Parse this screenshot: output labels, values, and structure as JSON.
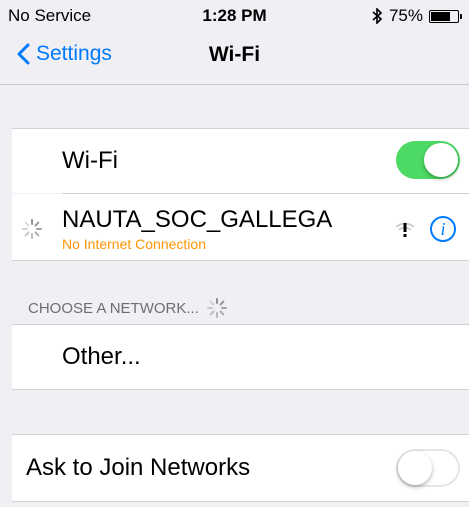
{
  "status_bar": {
    "carrier": "No Service",
    "time": "1:28 PM",
    "battery_percent": "75%",
    "battery_level": 0.75
  },
  "nav": {
    "back_label": "Settings",
    "title": "Wi-Fi"
  },
  "wifi_toggle": {
    "label": "Wi-Fi",
    "state": "on"
  },
  "current_network": {
    "name": "NAUTA_SOC_GALLEGA",
    "status": "No Internet Connection",
    "icons": [
      "loading-spinner-icon",
      "wifi-warning-icon",
      "info-icon"
    ]
  },
  "section": {
    "header": "CHOOSE A NETWORK..."
  },
  "other": {
    "label": "Other..."
  },
  "ask_to_join": {
    "label": "Ask to Join Networks",
    "state": "off"
  },
  "colors": {
    "accent": "#007aff",
    "toggle_on": "#4cd964",
    "warning_text": "#ff9500",
    "background": "#efeff4"
  }
}
